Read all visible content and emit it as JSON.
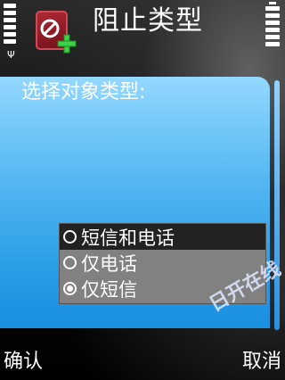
{
  "header": {
    "title": "阻止类型"
  },
  "content": {
    "prompt": "选择对象类型:"
  },
  "options": [
    {
      "label": "短信和电话",
      "selected": false,
      "highlighted": true
    },
    {
      "label": "仅电话",
      "selected": false,
      "highlighted": false
    },
    {
      "label": "仅短信",
      "selected": true,
      "highlighted": false
    }
  ],
  "softkeys": {
    "left": "确认",
    "right": "取消"
  },
  "watermark": "日开在线",
  "colors": {
    "panel_top": "#93d8ff",
    "panel_bottom": "#1a8fe0",
    "list_bg": "#818181",
    "highlight_bg": "#222222"
  },
  "icons": {
    "app": "block-contact-add-icon",
    "signal": "signal-strength-icon",
    "battery": "battery-level-icon"
  }
}
